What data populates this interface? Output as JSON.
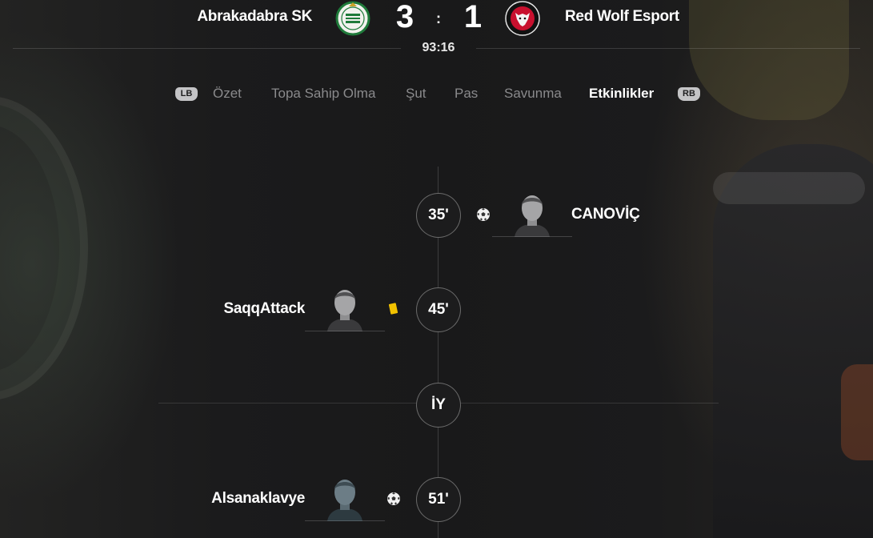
{
  "match": {
    "home_team": "Abrakadabra SK",
    "away_team": "Red Wolf Esport",
    "home_score": "3",
    "away_score": "1",
    "score_separator": ":",
    "clock": "93:16"
  },
  "tabs": {
    "left_bumper": "LB",
    "right_bumper": "RB",
    "items": [
      {
        "label": "Özet",
        "active": false
      },
      {
        "label": "Topa Sahip Olma",
        "active": false
      },
      {
        "label": "Şut",
        "active": false
      },
      {
        "label": "Pas",
        "active": false
      },
      {
        "label": "Savunma",
        "active": false
      },
      {
        "label": "Etkinlikler",
        "active": true
      }
    ]
  },
  "events": [
    {
      "minute": "35'",
      "side": "away",
      "player": "CANOVİÇ",
      "type": "goal",
      "icon": "soccer-ball-icon"
    },
    {
      "minute": "45'",
      "side": "home",
      "player": "SaqqAttack",
      "type": "yellow-card",
      "icon": "yellow-card-icon"
    },
    {
      "minute": "İY",
      "side": "none",
      "player": "",
      "type": "half-time",
      "icon": ""
    },
    {
      "minute": "51'",
      "side": "home",
      "player": "Alsanaklavye",
      "type": "goal",
      "icon": "soccer-ball-icon"
    }
  ],
  "colors": {
    "background": "#1c1c1d",
    "active_tab": "#ffffff",
    "inactive_tab": "#8a8a8c",
    "yellow_card": "#f2c200",
    "home_crest_green": "#1f7a3a",
    "away_crest_red": "#c8102e"
  }
}
